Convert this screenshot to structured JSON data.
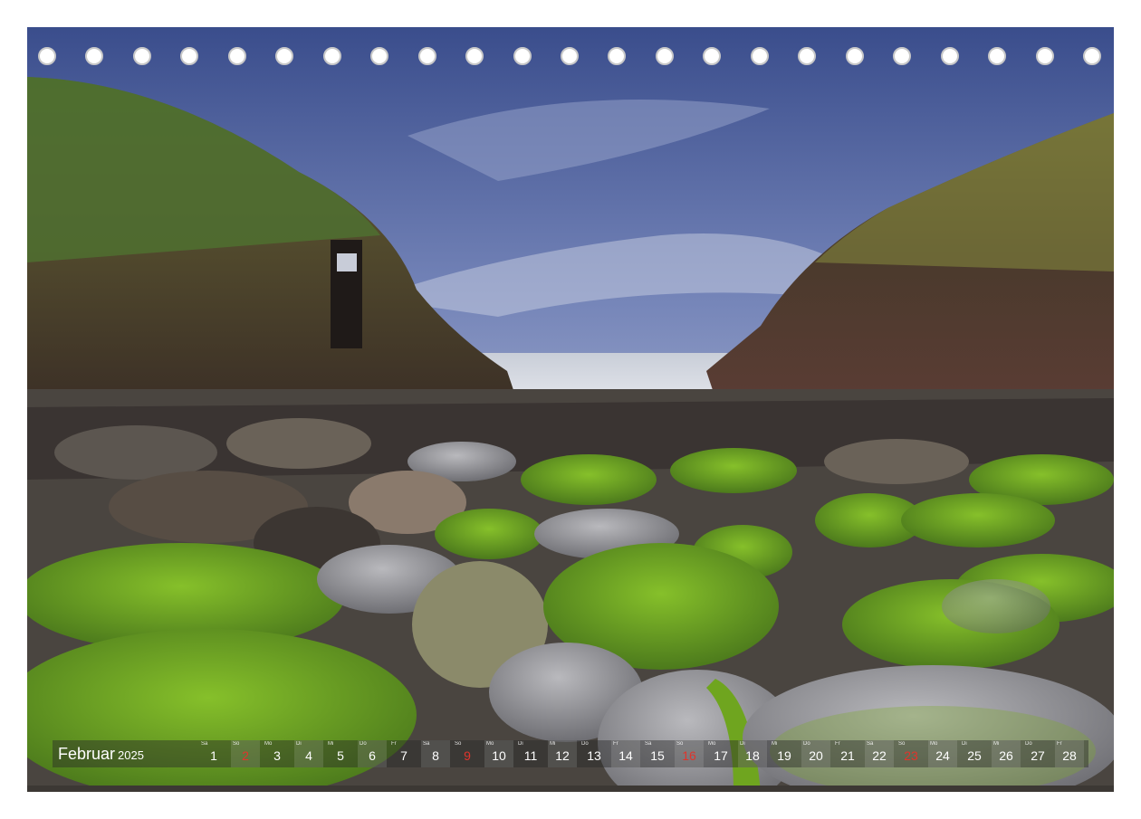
{
  "calendar": {
    "month": "Februar",
    "year": "2025",
    "days": [
      {
        "wd": "Sa",
        "num": "1",
        "type": "weekday"
      },
      {
        "wd": "So",
        "num": "2",
        "type": "sun"
      },
      {
        "wd": "Mo",
        "num": "3",
        "type": "weekday"
      },
      {
        "wd": "Di",
        "num": "4",
        "type": "weekday"
      },
      {
        "wd": "Mi",
        "num": "5",
        "type": "weekday"
      },
      {
        "wd": "Do",
        "num": "6",
        "type": "weekday"
      },
      {
        "wd": "Fr",
        "num": "7",
        "type": "weekday"
      },
      {
        "wd": "Sa",
        "num": "8",
        "type": "weekday"
      },
      {
        "wd": "So",
        "num": "9",
        "type": "sun"
      },
      {
        "wd": "Mo",
        "num": "10",
        "type": "weekday"
      },
      {
        "wd": "Di",
        "num": "11",
        "type": "weekday"
      },
      {
        "wd": "Mi",
        "num": "12",
        "type": "weekday"
      },
      {
        "wd": "Do",
        "num": "13",
        "type": "weekday"
      },
      {
        "wd": "Fr",
        "num": "14",
        "type": "weekday"
      },
      {
        "wd": "Sa",
        "num": "15",
        "type": "weekday"
      },
      {
        "wd": "So",
        "num": "16",
        "type": "sun"
      },
      {
        "wd": "Mo",
        "num": "17",
        "type": "weekday"
      },
      {
        "wd": "Di",
        "num": "18",
        "type": "weekday"
      },
      {
        "wd": "Mi",
        "num": "19",
        "type": "weekday"
      },
      {
        "wd": "Do",
        "num": "20",
        "type": "weekday"
      },
      {
        "wd": "Fr",
        "num": "21",
        "type": "weekday"
      },
      {
        "wd": "Sa",
        "num": "22",
        "type": "weekday"
      },
      {
        "wd": "So",
        "num": "23",
        "type": "sun"
      },
      {
        "wd": "Mo",
        "num": "24",
        "type": "weekday"
      },
      {
        "wd": "Di",
        "num": "25",
        "type": "weekday"
      },
      {
        "wd": "Mi",
        "num": "26",
        "type": "weekday"
      },
      {
        "wd": "Do",
        "num": "27",
        "type": "weekday"
      },
      {
        "wd": "Fr",
        "num": "28",
        "type": "weekday"
      }
    ]
  },
  "binding_holes": {
    "count": 23
  },
  "colors": {
    "sunday": "#e0342c",
    "bar": "#282828",
    "moss": "#6fa51f",
    "sky": "#6d7fb0"
  }
}
